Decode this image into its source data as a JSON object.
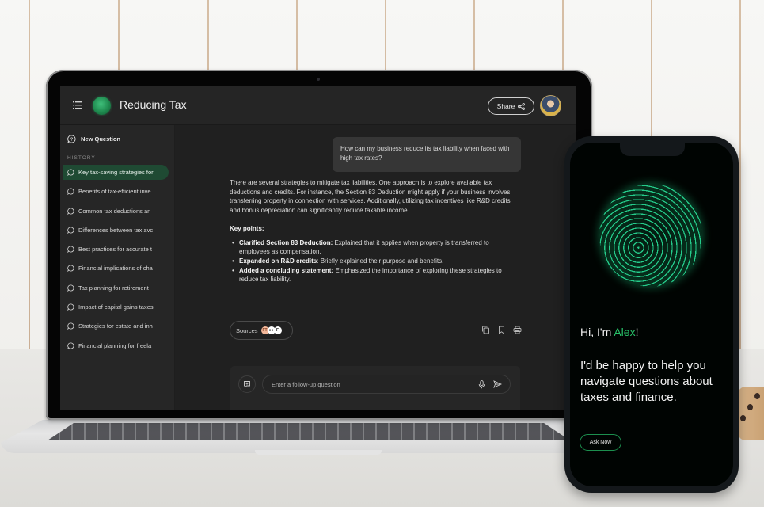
{
  "laptop_app": {
    "header": {
      "title": "Reducing Tax",
      "share_label": "Share"
    },
    "sidebar": {
      "new_question_label": "New Question",
      "history_label": "HISTORY",
      "items": [
        {
          "label": "Key tax-saving strategies for",
          "active": true
        },
        {
          "label": "Benefits of tax-efficient inve",
          "active": false
        },
        {
          "label": "Common tax deductions an",
          "active": false
        },
        {
          "label": "Differences between tax avc",
          "active": false
        },
        {
          "label": "Best practices for accurate t",
          "active": false
        },
        {
          "label": "Financial implications of cha",
          "active": false
        },
        {
          "label": "Tax planning for retirement",
          "active": false
        },
        {
          "label": "Impact of capital gains taxes",
          "active": false
        },
        {
          "label": "Strategies for estate and inh",
          "active": false
        },
        {
          "label": "Financial planning for freela",
          "active": false
        }
      ]
    },
    "conversation": {
      "user_question": "How can my business reduce its tax liability when faced with high tax rates?",
      "answer_paragraph": "There are several strategies to mitigate tax liabilities. One approach is to explore available tax deductions and credits. For instance, the Section 83 Deduction might apply if your business involves transferring property in connection with services. Additionally, utilizing tax incentives like R&D credits and bonus depreciation can significantly reduce taxable income.",
      "key_points_heading": "Key points:",
      "key_points": [
        {
          "title": "Clarified Section 83 Deduction:",
          "text": " Explained that it applies when property is transferred to employees as compensation."
        },
        {
          "title": "Expanded on R&D credits",
          "text": ": Briefly explained their purpose and benefits."
        },
        {
          "title": "Added a concluding statement:",
          "text": " Emphasized the importance of exploring these strategies to reduce tax liability."
        }
      ],
      "sources_label": "Sources",
      "source_badges": [
        "FT",
        "●●",
        "F"
      ]
    },
    "composer": {
      "placeholder": "Enter a follow-up question"
    }
  },
  "phone_app": {
    "greeting_prefix": "Hi, I'm ",
    "assistant_name": "Alex",
    "greeting_suffix": "!",
    "tagline": "I'd be happy to help you navigate questions about taxes and finance.",
    "cta_label": "Ask Now"
  },
  "colors": {
    "accent_green": "#28c36a",
    "active_history_bg": "#1f4a33",
    "app_bg": "#202020"
  }
}
